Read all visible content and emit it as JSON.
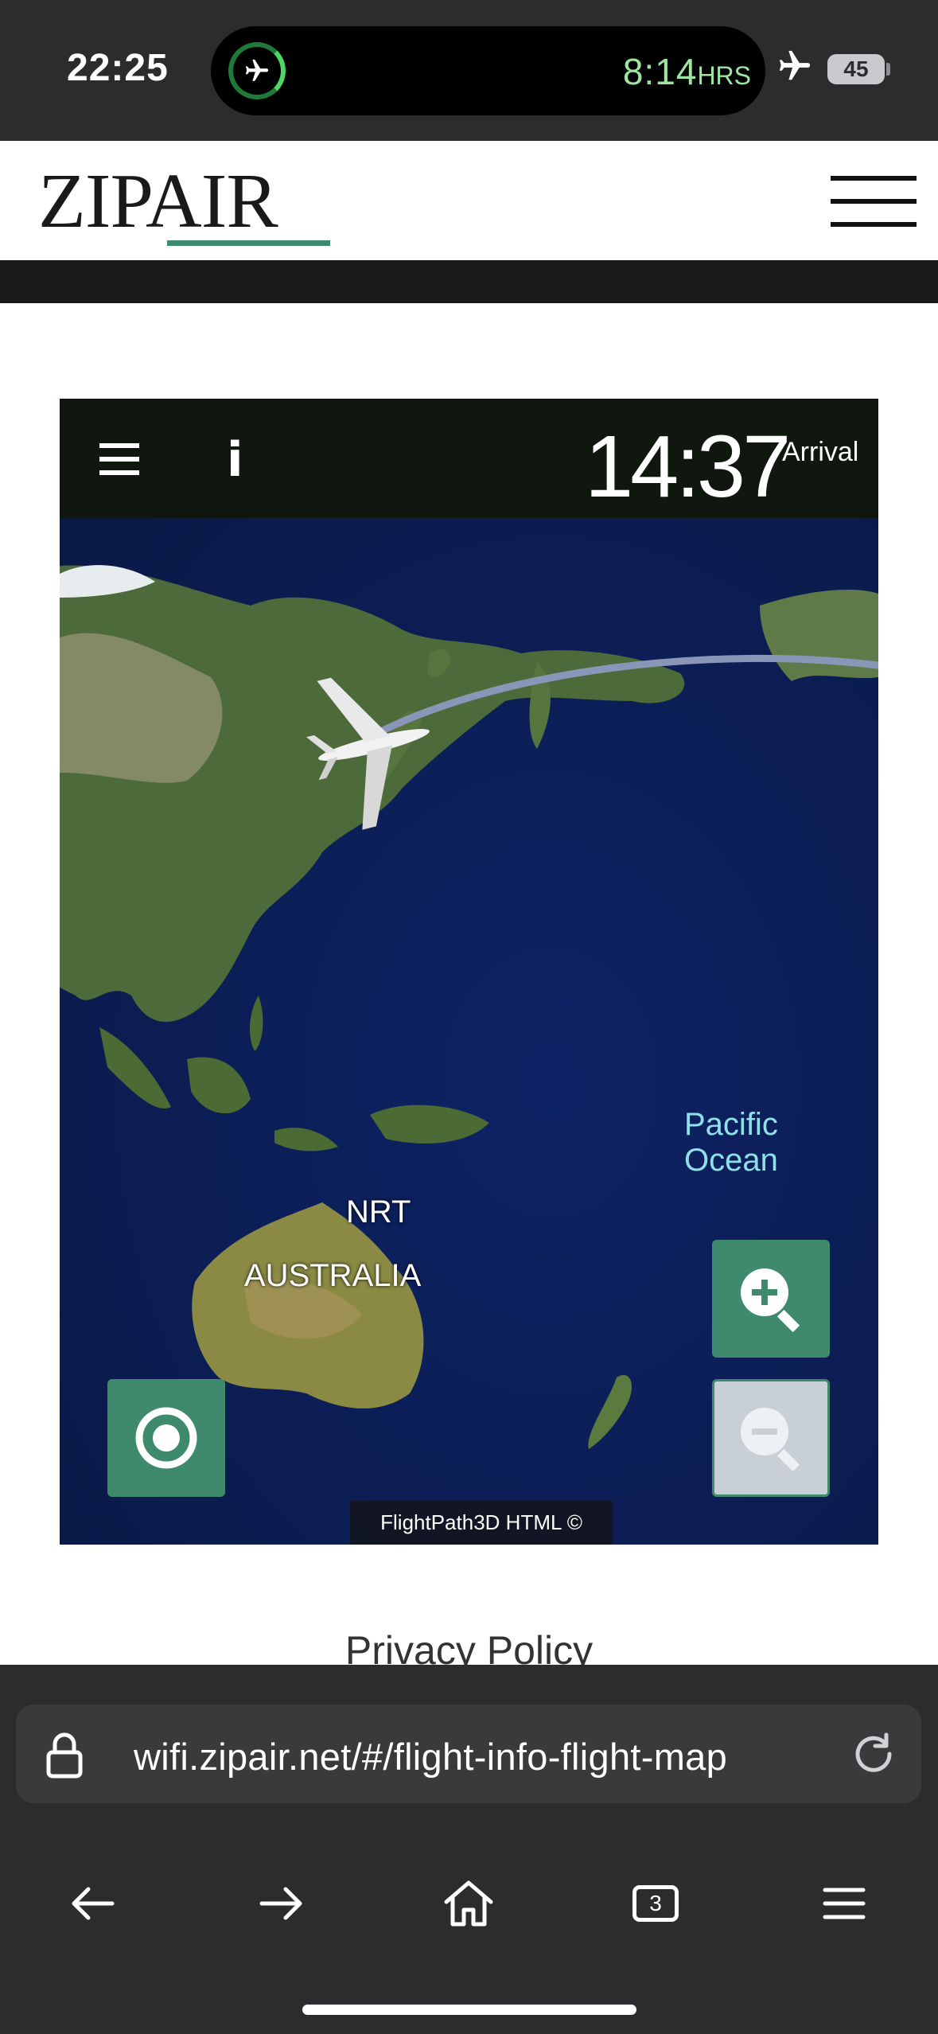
{
  "status_bar": {
    "time": "22:25",
    "timer_value": "8:14",
    "timer_unit": "HRS",
    "battery": "45"
  },
  "site": {
    "logo": "ZIPAIR"
  },
  "flight_map": {
    "arrival_time": "14:37",
    "arrival_label": "Arrival",
    "info_label": "i",
    "labels": {
      "airport": "NRT",
      "continent": "AUSTRALIA",
      "ocean": "Pacific Ocean"
    },
    "credit": "FlightPath3D HTML ©",
    "colors": {
      "button_green": "#3f8a6d",
      "ocean": "#0b1c4e",
      "route": "#8a96b8"
    }
  },
  "footer": {
    "privacy_link": "Privacy Policy"
  },
  "browser": {
    "url": "wifi.zipair.net/#/flight-info-flight-map",
    "tabs_count": "3",
    "icons": [
      "lock-icon",
      "reload-icon",
      "back-arrow-icon",
      "forward-arrow-icon",
      "home-icon",
      "tabs-icon",
      "menu-icon"
    ]
  }
}
